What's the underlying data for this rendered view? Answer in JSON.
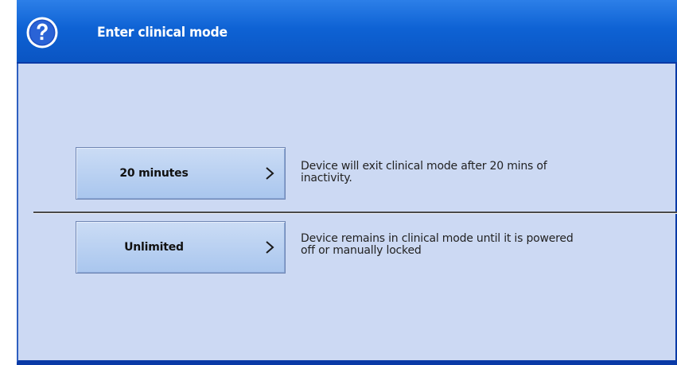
{
  "dialog": {
    "title": "Enter clinical mode",
    "help_icon": "help-icon",
    "chevron_icon": "chevron-right-icon"
  },
  "options": [
    {
      "label": "20 minutes",
      "description_line1": "Device will exit clinical mode after 20 mins of",
      "description_line2": "inactivity."
    },
    {
      "label": "Unlimited",
      "description_line1": "Device remains in clinical mode until it is powered",
      "description_line2": "off or manually locked"
    }
  ],
  "colors": {
    "titlebar": "#0e62d4",
    "content_background": "#ccd9f3",
    "button_background": "#a9c6ee",
    "title_text": "#ffffff"
  }
}
